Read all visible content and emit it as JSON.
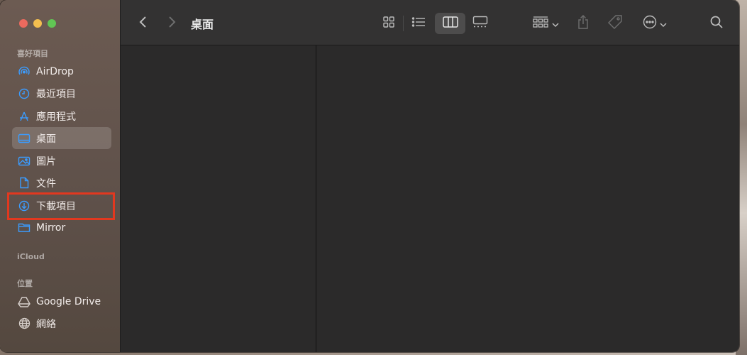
{
  "window": {
    "title": "桌面"
  },
  "sidebar": {
    "favorites_title": "喜好項目",
    "items": [
      {
        "label": "AirDrop",
        "icon": "airdrop-icon"
      },
      {
        "label": "最近項目",
        "icon": "clock-icon"
      },
      {
        "label": "應用程式",
        "icon": "applications-icon"
      },
      {
        "label": "桌面",
        "icon": "desktop-icon"
      },
      {
        "label": "圖片",
        "icon": "photo-icon"
      },
      {
        "label": "文件",
        "icon": "document-icon"
      },
      {
        "label": "下載項目",
        "icon": "download-icon"
      },
      {
        "label": "Mirror",
        "icon": "folder-icon"
      }
    ],
    "icloud_title": "iCloud",
    "locations_title": "位置",
    "locations": [
      {
        "label": "Google Drive",
        "icon": "drive-icon"
      },
      {
        "label": "網絡",
        "icon": "network-icon"
      }
    ]
  },
  "colors": {
    "accent": "#3b9cff",
    "highlight_border": "#e2381f"
  }
}
